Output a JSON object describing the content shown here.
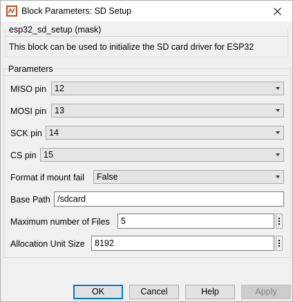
{
  "window": {
    "title": "Block Parameters: SD Setup"
  },
  "mask": {
    "name": "esp32_sd_setup (mask)",
    "description": "This block can be used to initialize the SD card driver for ESP32"
  },
  "parameters": {
    "group_title": "Parameters",
    "miso": {
      "label": "MISO pin",
      "value": "12"
    },
    "mosi": {
      "label": "MOSI pin",
      "value": "13"
    },
    "sck": {
      "label": "SCK pin",
      "value": "14"
    },
    "cs": {
      "label": "CS pin",
      "value": "15"
    },
    "format": {
      "label": "Format if mount fail",
      "value": "False"
    },
    "base_path": {
      "label": "Base Path",
      "value": "/sdcard"
    },
    "max_files": {
      "label": "Maximum number of Files",
      "value": "5"
    },
    "alloc_unit": {
      "label": "Allocation Unit Size",
      "value": "8192"
    }
  },
  "buttons": {
    "ok": "OK",
    "cancel": "Cancel",
    "help": "Help",
    "apply": "Apply"
  },
  "colors": {
    "accent": "#0078d7",
    "window_bg": "#f0f0f0"
  }
}
